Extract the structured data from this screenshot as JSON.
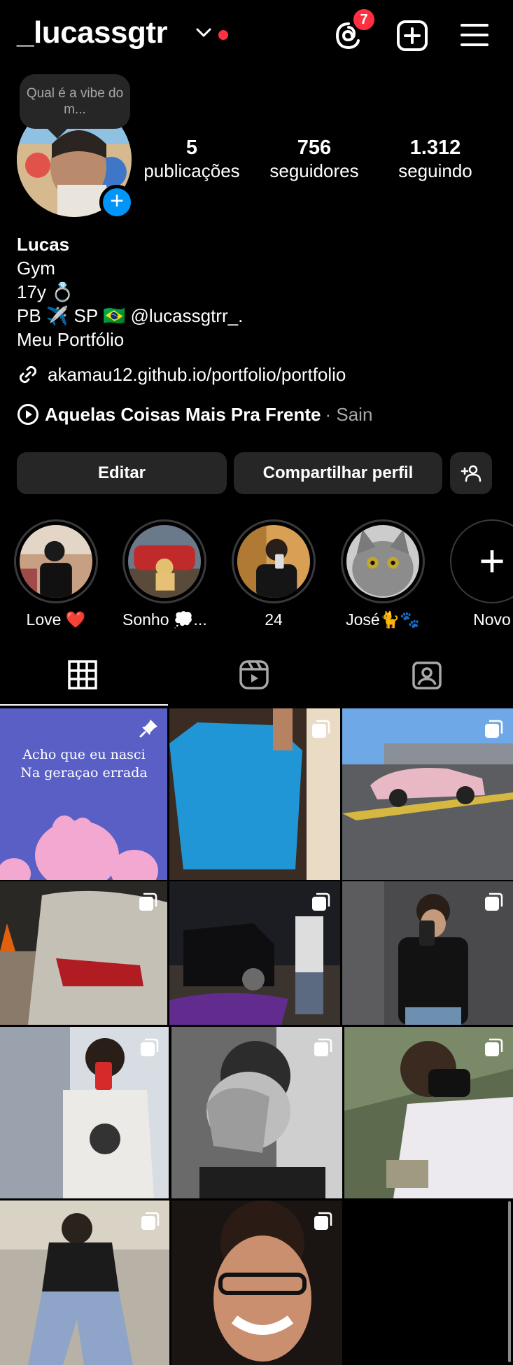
{
  "header": {
    "username": "_lucassgtr",
    "notification_count": "7"
  },
  "note": {
    "text": "Qual é a vibe do m..."
  },
  "stats": [
    {
      "value": "5",
      "label": "publicações"
    },
    {
      "value": "756",
      "label": "seguidores"
    },
    {
      "value": "1.312",
      "label": "seguindo"
    }
  ],
  "bio": {
    "name": "Lucas",
    "lines": [
      "Gym",
      "17y 💍",
      "PB ✈️ SP 🇧🇷 @lucassgtrr_.",
      "Meu Portfólio"
    ],
    "link": "akamau12.github.io/portfolio/portfolio",
    "music_title": "Aquelas Coisas Mais Pra Frente",
    "music_artist": "· Sain"
  },
  "buttons": {
    "edit": "Editar",
    "share": "Compartilhar perfil"
  },
  "highlights": [
    {
      "label": "Love ❤️"
    },
    {
      "label": "Sonho 💭..."
    },
    {
      "label": "24"
    },
    {
      "label": "José🐈🐾"
    },
    {
      "label": "Novo"
    }
  ],
  "grid": {
    "post_1_caption_line1": "Acho que eu nasci",
    "post_1_caption_line2": "Na geraçao errada"
  },
  "colors": {
    "background": "#000000",
    "button": "#262626",
    "accent_blue": "#0095f6",
    "badge_red": "#ff3040",
    "muted_text": "#a8a8a8"
  },
  "icons": [
    "chevron-down-icon",
    "threads-icon",
    "plus-square-icon",
    "menu-icon",
    "link-icon",
    "play-icon",
    "add-user-icon",
    "grid-icon",
    "reels-icon",
    "tagged-icon",
    "pin-icon",
    "carousel-icon"
  ]
}
